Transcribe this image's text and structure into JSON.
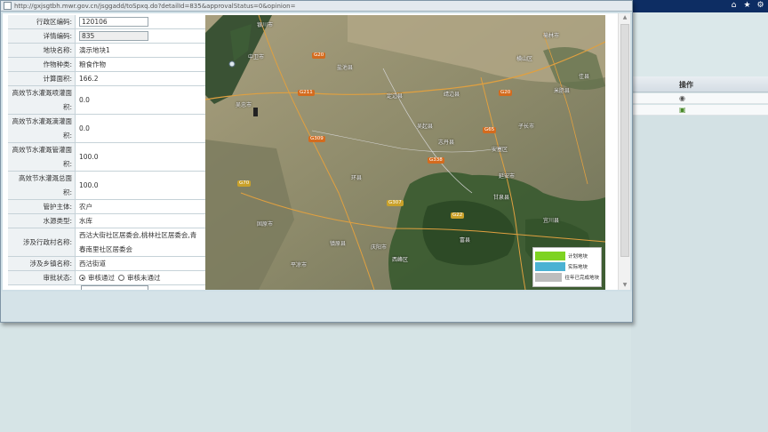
{
  "window": {
    "url": "http://gxjsgtbh.mwr.gov.cn/jsggadd/toSpxq.do?detailId=835&approvalStatus=0&opinion="
  },
  "background": {
    "tools": [
      "home-icon",
      "star-icon",
      "gear-icon"
    ],
    "table_header": "操作",
    "row_icons": [
      "view-icon",
      "edit-icon"
    ]
  },
  "form": {
    "fields": {
      "region_code_label": "行政区编码:",
      "region_code": "120106",
      "detail_code_label": "详情编码:",
      "detail_code": "835",
      "plot_name_label": "地块名称:",
      "plot_name": "演示地块1",
      "crop_type_label": "作物种类:",
      "crop_type": "粮食作物",
      "calc_area_label": "计算面积:",
      "calc_area": "166.2",
      "spray_area_label": "高效节水灌溉喷灌面积:",
      "spray_area": "0.0",
      "drip_area_label": "高效节水灌溉滴灌面积:",
      "drip_area": "0.0",
      "pipe_area_label": "高效节水灌溉管灌面积:",
      "pipe_area": "100.0",
      "total_area_label": "高效节水灌溉总面积:",
      "total_area": "100.0",
      "manager_label": "管护主体:",
      "manager": "农户",
      "water_source_label": "水源类型:",
      "water_source": "水库",
      "villages_label": "涉及行政村名称:",
      "villages": "西沽大街社区居委会,桃林社区居委会,青春南里社区居委会",
      "town_label": "涉及乡镇名称:",
      "town": "西沽街道",
      "approval_label": "审批状态:",
      "approval_options": [
        "审核通过",
        "审核未通过"
      ]
    }
  },
  "map": {
    "places": [
      "榆林市",
      "银川市",
      "中卫市",
      "延安市",
      "庆阳市",
      "平凉市",
      "固原市",
      "吴忠市",
      "靖边县",
      "定边县",
      "子长市",
      "安塞区",
      "志丹县",
      "甘泉县",
      "盐池县",
      "环县",
      "镇原县",
      "西峰区",
      "米脂县",
      "横山区",
      "佳县",
      "富县",
      "宜川县",
      "吴起县"
    ],
    "roads": [
      "G20",
      "G70",
      "G65",
      "G22",
      "G309",
      "G211",
      "G307",
      "G338"
    ],
    "legend": [
      {
        "label": "计划地块",
        "color": "#7ed321"
      },
      {
        "label": "实际地块",
        "color": "#4bb2d3"
      },
      {
        "label": "往年已完成地块",
        "color": "#bdbdbd"
      }
    ]
  }
}
